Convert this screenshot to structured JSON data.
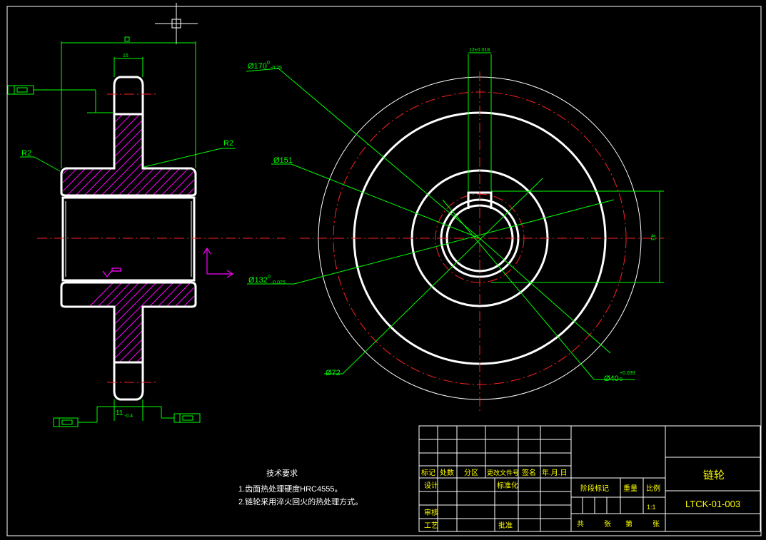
{
  "drawing": {
    "title": "链轮",
    "drawing_number": "LTCK-01-003",
    "tech_requirements": {
      "heading": "技术要求",
      "items": [
        "1.齿面热处理硬度HRC4555。",
        "2.链轮采用淬火回火的热处理方式。"
      ]
    },
    "dimensions": {
      "d170": "Ø170",
      "d170_tol": "-0.25",
      "d170_sup": "0",
      "d151": "Ø151",
      "d132": "Ø132",
      "d132_tol": "-0.025",
      "d132_sup": "0",
      "d72": "Ø72",
      "d40": "Ø40",
      "d40_sup": "+0.039",
      "d40_sub": "0",
      "r2_left": "R2",
      "r2_right": "R2",
      "width_bottom": "11",
      "width_bottom_tol": "-0.4",
      "keyway": "12±0.018"
    },
    "title_block": {
      "header_row": [
        "标记",
        "处数",
        "分区",
        "更改文件号",
        "签名",
        "年.月.日"
      ],
      "design": "设计",
      "standardize": "标准化",
      "review": "审核",
      "process": "工艺",
      "approve": "批准",
      "stage_mark": "阶段标记",
      "weight": "重量",
      "scale": "比例",
      "scale_value": "1:1",
      "total_sheets": "共",
      "sheets_unit1": "张",
      "sheet_no": "第",
      "sheets_unit2": "张"
    }
  },
  "colors": {
    "background": "#000000",
    "dimension": "#00ff00",
    "outline": "#ffffff",
    "centerline": "#ff2020",
    "hatch": "#ff00ff",
    "text": "#ffff00"
  }
}
